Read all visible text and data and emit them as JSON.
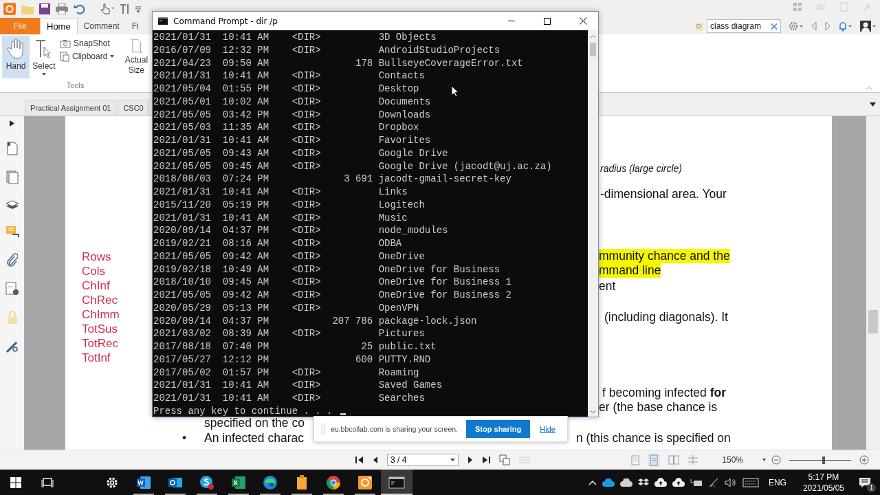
{
  "ribbon_tabs": [
    {
      "label": "File",
      "kind": "file",
      "selected": false
    },
    {
      "label": "Home",
      "kind": "tab",
      "selected": true
    },
    {
      "label": "Comment",
      "kind": "tab",
      "selected": false
    },
    {
      "label": "Fi",
      "kind": "tab",
      "selected": false
    }
  ],
  "ribbon": {
    "tools": [
      {
        "label": "Hand",
        "selected": true
      },
      {
        "label": "Select",
        "selected": false
      }
    ],
    "small_buttons": [
      "SnapShot",
      "Clipboard"
    ],
    "actual_size": "Actual Size",
    "group_label": "Tools"
  },
  "search": {
    "value": "class diagram"
  },
  "document_tabs": [
    "Practical Assignment 01",
    "CSC0"
  ],
  "document": {
    "red_list": [
      "Rows",
      "Cols",
      "ChInf",
      "ChRec",
      "ChImm",
      "TotSus",
      "TotRec",
      "TotInf"
    ],
    "fragments": [
      {
        "text": "radius (large circle)",
        "kind": "italic",
        "highlighted": false
      },
      {
        "text": "-dimensional area. Your",
        "kind": "body",
        "highlighted": false
      },
      {
        "text": "mmunity chance and the",
        "kind": "body",
        "highlighted": true
      },
      {
        "text": "mmand line",
        "kind": "body",
        "highlighted": true
      },
      {
        "text": "ent",
        "kind": "body",
        "highlighted": false
      },
      {
        "text": "(including diagonals). It",
        "kind": "body",
        "highlighted": false
      },
      {
        "text": "f becoming infected **for**",
        "kind": "body",
        "highlighted": false
      },
      {
        "text": "er (the base chance is",
        "kind": "body",
        "highlighted": false
      },
      {
        "text": "specified on the co",
        "kind": "body",
        "highlighted": false
      },
      {
        "text": "•",
        "kind": "bullet",
        "highlighted": false
      },
      {
        "text": "An infected charac",
        "kind": "body",
        "highlighted": false
      },
      {
        "text": "n (this chance is specified on",
        "kind": "body",
        "highlighted": false
      }
    ]
  },
  "status_bar": {
    "page": "3 / 4",
    "zoom": "150%",
    "zoom_slider": {
      "level": 0.55
    }
  },
  "command_prompt": {
    "title": "Command Prompt - dir /p",
    "lines": [
      "2021/01/31  10:41 AM    <DIR>          3D Objects",
      "2016/07/09  12:32 PM    <DIR>          AndroidStudioProjects",
      "2021/04/23  09:50 AM               178 BullseyeCoverageError.txt",
      "2021/01/31  10:41 AM    <DIR>          Contacts",
      "2021/05/04  01:55 PM    <DIR>          Desktop",
      "2021/05/01  10:02 AM    <DIR>          Documents",
      "2021/05/05  03:42 PM    <DIR>          Downloads",
      "2021/05/03  11:35 AM    <DIR>          Dropbox",
      "2021/01/31  10:41 AM    <DIR>          Favorites",
      "2021/05/05  09:43 AM    <DIR>          Google Drive",
      "2021/05/05  09:45 AM    <DIR>          Google Drive (jacodt@uj.ac.za)",
      "2018/08/03  07:24 PM             3 691 jacodt-gmail-secret-key",
      "2021/01/31  10:41 AM    <DIR>          Links",
      "2015/11/20  05:19 PM    <DIR>          Logitech",
      "2021/01/31  10:41 AM    <DIR>          Music",
      "2020/09/14  04:37 PM    <DIR>          node_modules",
      "2019/02/21  08:16 AM    <DIR>          ODBA",
      "2021/05/05  09:42 AM    <DIR>          OneDrive",
      "2019/02/18  10:49 AM    <DIR>          OneDrive for Business",
      "2018/10/10  09:45 AM    <DIR>          OneDrive for Business 1",
      "2021/05/05  09:42 AM    <DIR>          OneDrive for Business 2",
      "2020/05/29  05:13 PM    <DIR>          OpenVPN",
      "2020/09/14  04:37 PM           207 786 package-lock.json",
      "2021/03/02  08:39 AM    <DIR>          Pictures",
      "2017/08/18  07:40 PM                25 public.txt",
      "2017/05/27  12:12 PM               600 PUTTY.RND",
      "2017/05/02  01:57 PM    <DIR>          Roaming",
      "2021/01/31  10:41 AM    <DIR>          Saved Games",
      "2021/01/31  10:41 AM    <DIR>          Searches"
    ],
    "prompt": "Press any key to continue . . ."
  },
  "screen_share": {
    "message": "eu.bbcollab.com is sharing your screen.",
    "stop_button": "Stop sharing",
    "hide_link": "Hide"
  },
  "taskbar": {
    "apps": [
      {
        "kind": "settings",
        "running": false,
        "selected": false
      },
      {
        "kind": "word",
        "running": true,
        "selected": false
      },
      {
        "kind": "outlook",
        "running": true,
        "selected": false
      },
      {
        "kind": "skype",
        "running": true,
        "selected": false
      },
      {
        "kind": "excel",
        "running": true,
        "selected": false
      },
      {
        "kind": "edge",
        "running": true,
        "selected": false
      },
      {
        "kind": "files",
        "running": true,
        "selected": false
      },
      {
        "kind": "chrome",
        "running": true,
        "selected": false
      },
      {
        "kind": "reader",
        "running": true,
        "selected": false
      },
      {
        "kind": "terminal",
        "running": true,
        "selected": true
      }
    ],
    "language": "ENG",
    "time": "5:17 PM",
    "date": "2021/05/05",
    "notifications": "1"
  }
}
